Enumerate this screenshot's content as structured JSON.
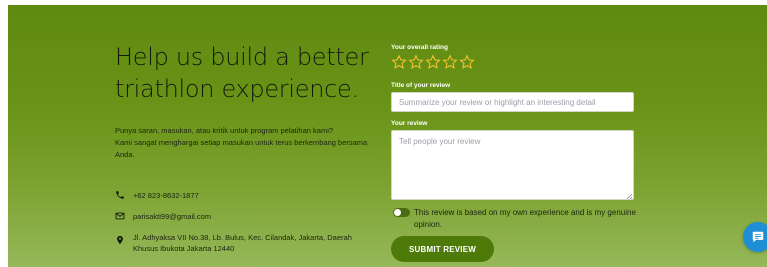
{
  "hero": {
    "heading": "Help us build a better triathlon experience.",
    "intro_line1": "Punya saran, masukan, atau kritik untuk program pelatihan kami?",
    "intro_line2": "Kami sangat menghargai setiap masukan untuk terus berkembang bersama Anda.",
    "phone": "+62 823-8632-1877",
    "email": "parisakti99@gmail.com",
    "address": "Jl. Adhyaksa VII No.38, Lb. Bulus, Kec. Cilandak, Jakarta, Daerah Khusus Ibukota Jakarta 12440",
    "icons": {
      "phone": "phone-icon",
      "email": "mail-icon",
      "address": "map-pin-icon"
    }
  },
  "form": {
    "rating_label": "Your overall rating",
    "rating_value": 0,
    "rating_max": 5,
    "title_label": "Title of your review",
    "title_placeholder": "Summarize your review or highlight an interesting detail",
    "title_value": "",
    "review_label": "Your review",
    "review_placeholder": "Tell people your review",
    "review_value": "",
    "consent_label": "This review is based on my own experience and is my genuine opinion.",
    "consent_checked": false,
    "submit_label": "SUBMIT REVIEW"
  },
  "colors": {
    "hero_top": "#5f8a10",
    "hero_bottom": "#96b85a",
    "button": "#4e7a0a",
    "star_outline": "#f2c230",
    "chat_button": "#1e8fd5"
  },
  "chat": {
    "icon": "chat-icon"
  }
}
